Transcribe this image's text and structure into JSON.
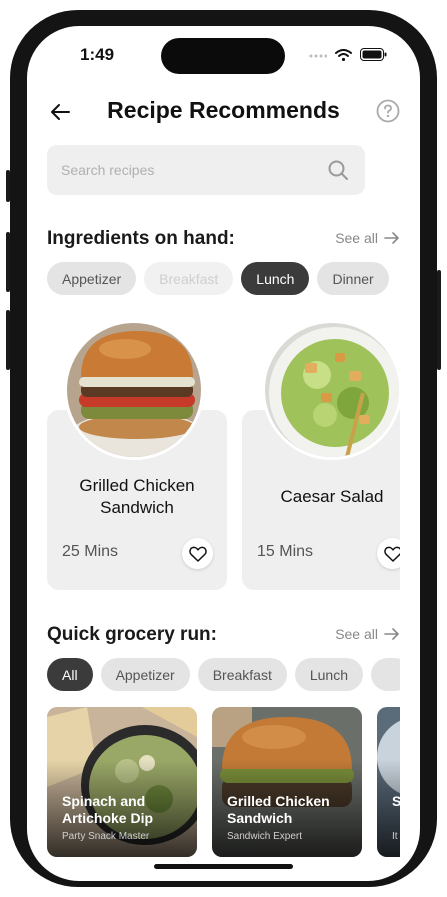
{
  "status_bar": {
    "time": "1:49"
  },
  "header": {
    "title": "Recipe Recommends"
  },
  "search": {
    "placeholder": "Search recipes"
  },
  "ingredients": {
    "title": "Ingredients on hand:",
    "see_all": "See all",
    "chips": [
      "Appetizer",
      "Breakfast",
      "Lunch",
      "Dinner"
    ],
    "selected": "Lunch",
    "recipes": [
      {
        "name": "Grilled Chicken Sandwich",
        "time": "25 Mins"
      },
      {
        "name": "Caesar Salad",
        "time": "15 Mins"
      }
    ]
  },
  "grocery": {
    "title": "Quick grocery run:",
    "see_all": "See all",
    "chips": [
      "All",
      "Appetizer",
      "Breakfast",
      "Lunch"
    ],
    "selected": "All",
    "cards": [
      {
        "name": "Spinach and Artichoke Dip",
        "subtitle": "Party Snack Master"
      },
      {
        "name": "Grilled Chicken Sandwich",
        "subtitle": "Sandwich Expert"
      },
      {
        "name": "S M",
        "subtitle": "It"
      }
    ]
  },
  "colors": {
    "accent": "#3b3b3b",
    "chip": "#e4e4e4",
    "card": "#efefef"
  }
}
